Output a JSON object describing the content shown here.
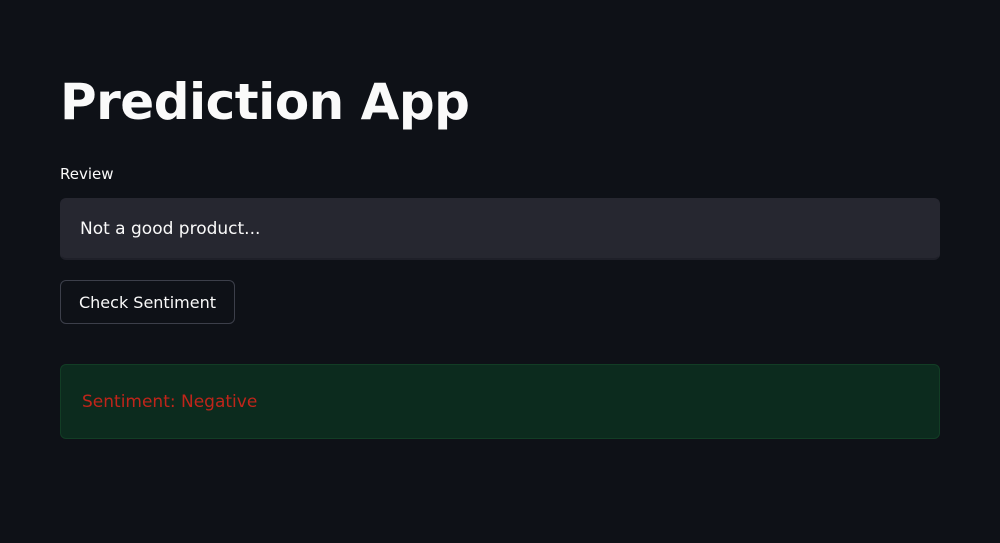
{
  "app": {
    "title": "Prediction App"
  },
  "review": {
    "label": "Review",
    "value": "Not a good product...",
    "placeholder": ""
  },
  "actions": {
    "check_label": "Check Sentiment"
  },
  "result": {
    "text": "Sentiment: Negative",
    "text_color": "#c0251a",
    "background_color": "#0c2b1e"
  },
  "theme": {
    "background": "#0e1117",
    "input_background": "#262730",
    "text": "#fafafa"
  }
}
